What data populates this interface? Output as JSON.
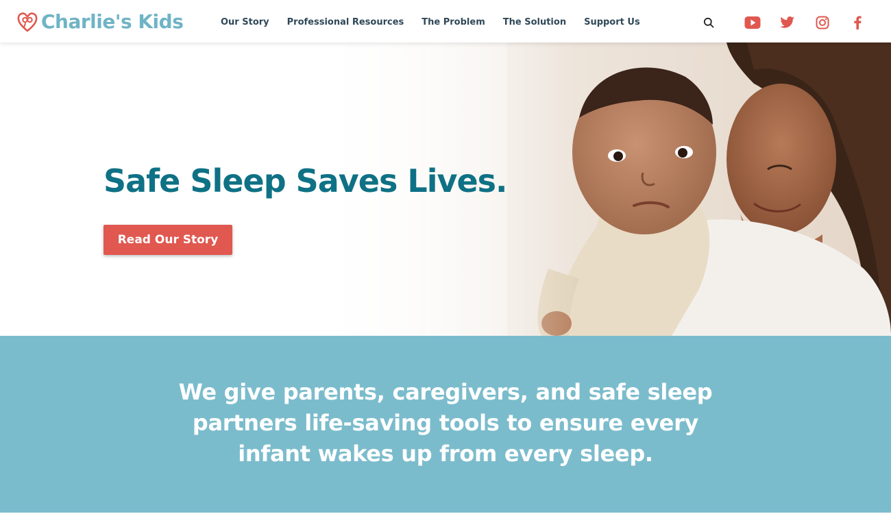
{
  "brand": {
    "name": "Charlie's Kids",
    "logo_icon": "heart-pacifier-icon",
    "color_primary": "#6fb4c5",
    "color_accent": "#e0584f"
  },
  "nav": {
    "items": [
      {
        "label": "Our Story"
      },
      {
        "label": "Professional Resources"
      },
      {
        "label": "The Problem"
      },
      {
        "label": "The Solution"
      },
      {
        "label": "Support Us"
      }
    ]
  },
  "header_icons": {
    "search": "search-icon",
    "youtube": "youtube-icon",
    "twitter": "twitter-icon",
    "instagram": "instagram-icon",
    "facebook": "facebook-icon"
  },
  "hero": {
    "title": "Safe Sleep Saves Lives.",
    "button_label": "Read Our Story",
    "title_color": "#0f7185"
  },
  "mission": {
    "text": "We give parents, caregivers, and safe sleep partners life-saving tools to ensure every infant wakes up from every sleep.",
    "background": "#7bbccc"
  }
}
